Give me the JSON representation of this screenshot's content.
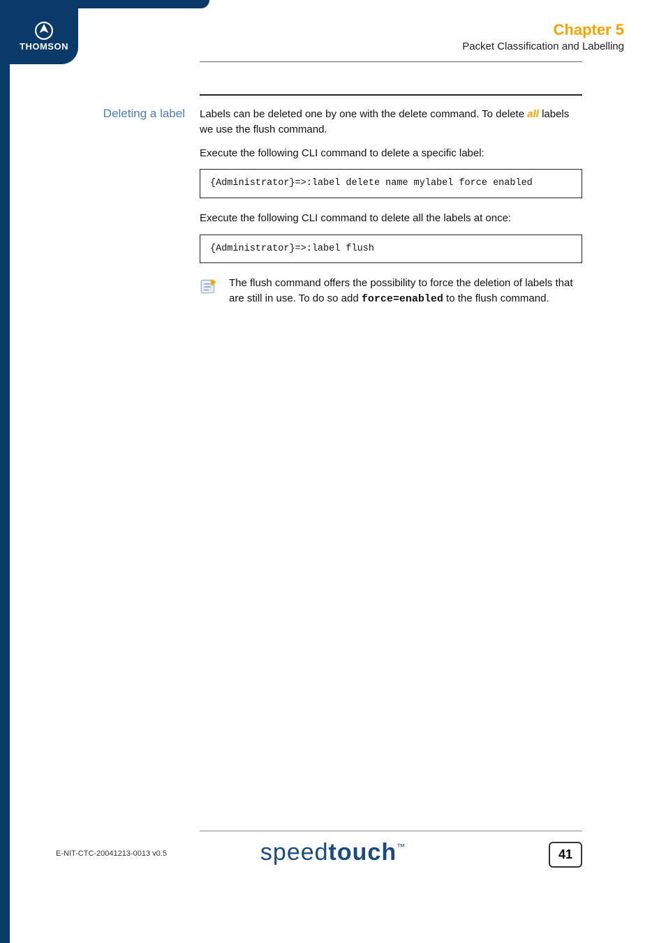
{
  "logo": {
    "brand": "THOMSON"
  },
  "header": {
    "chapter": "Chapter 5",
    "subtitle": "Packet Classification and Labelling"
  },
  "section": {
    "side_heading": "Deleting a label",
    "para1_a": "Labels can be deleted one by one with the delete command. To delete ",
    "para1_emph": "all",
    "para1_b": " labels we use the flush command.",
    "para2": "Execute the following CLI command to delete a specific label:",
    "code1": "{Administrator}=>:label delete name mylabel force enabled",
    "para3": "Execute the following CLI command to delete all the labels at once:",
    "code2": "{Administrator}=>:label flush",
    "note_a": "The flush command offers the possibility to force the deletion of labels that are still in use. To do so add ",
    "note_code": "force=enabled",
    "note_b": " to the flush command."
  },
  "footer": {
    "docid": "E-NIT-CTC-20041213-0013 v0.5",
    "logo_light": "speed",
    "logo_bold": "touch",
    "tm": "™",
    "page": "41"
  }
}
